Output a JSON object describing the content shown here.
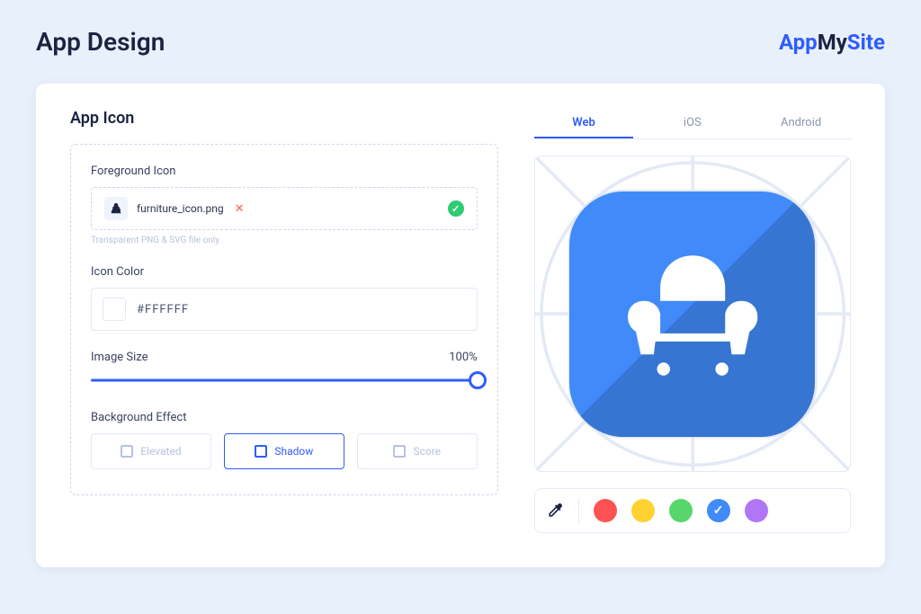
{
  "page": {
    "title": "App Design"
  },
  "brand": {
    "part1": "App",
    "part2": "My",
    "part3": "Site"
  },
  "section": {
    "title": "App Icon"
  },
  "foreground": {
    "label": "Foreground Icon",
    "filename": "furniture_icon.png",
    "hint": "Transparent PNG & SVG file only"
  },
  "icon_color": {
    "label": "Icon Color",
    "hex": "#FFFFFF"
  },
  "image_size": {
    "label": "Image Size",
    "value": "100%"
  },
  "background_effect": {
    "label": "Background Effect",
    "options": [
      {
        "label": "Elevated",
        "active": false
      },
      {
        "label": "Shadow",
        "active": true
      },
      {
        "label": "Score",
        "active": false
      }
    ]
  },
  "preview": {
    "tabs": [
      {
        "label": "Web",
        "active": true
      },
      {
        "label": "iOS",
        "active": false
      },
      {
        "label": "Android",
        "active": false
      }
    ],
    "swatches": {
      "colors": [
        "#ff5252",
        "#ffd233",
        "#56d66b",
        "#408bf9",
        "#b076f5"
      ],
      "selected_index": 3
    }
  }
}
